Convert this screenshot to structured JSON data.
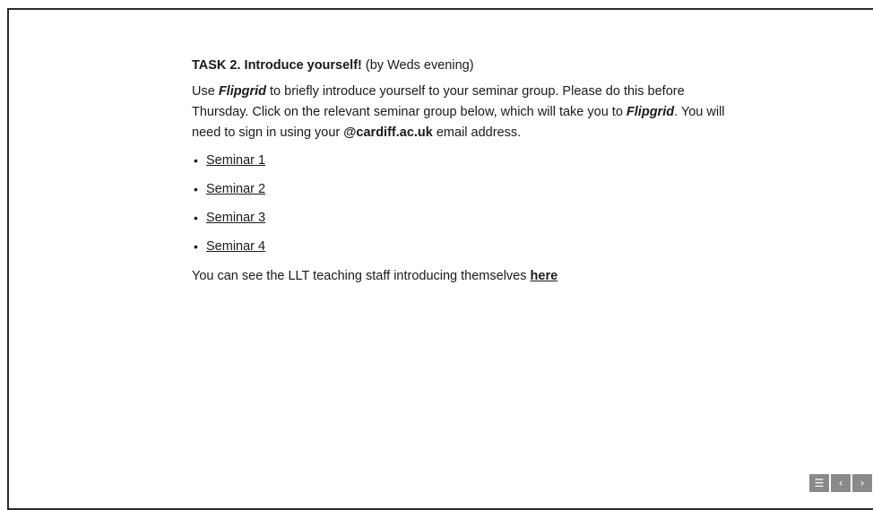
{
  "task": {
    "title_bold": "TASK 2. Introduce yourself!",
    "title_rest": " (by Weds evening)"
  },
  "instructions": {
    "part1": "Use ",
    "flipgrid1": "Flipgrid",
    "part2": " to briefly introduce yourself to your seminar group. Please do this before Thursday. Click on the relevant seminar group below, which will take you to ",
    "flipgrid2": "Flipgrid",
    "part3": ". You will need to sign in using your ",
    "email_domain": "@cardiff.ac.uk",
    "part4": " email address."
  },
  "seminars": [
    "Seminar 1",
    "Seminar 2",
    "Seminar 3",
    "Seminar 4"
  ],
  "footer": {
    "text": "You can see the LLT teaching staff introducing themselves ",
    "link": "here"
  },
  "nav": {
    "menu_icon": "list-menu-icon",
    "prev_icon": "chevron-left-icon",
    "next_icon": "chevron-right-icon",
    "menu_glyph": "☰",
    "prev_glyph": "‹",
    "next_glyph": "›"
  }
}
